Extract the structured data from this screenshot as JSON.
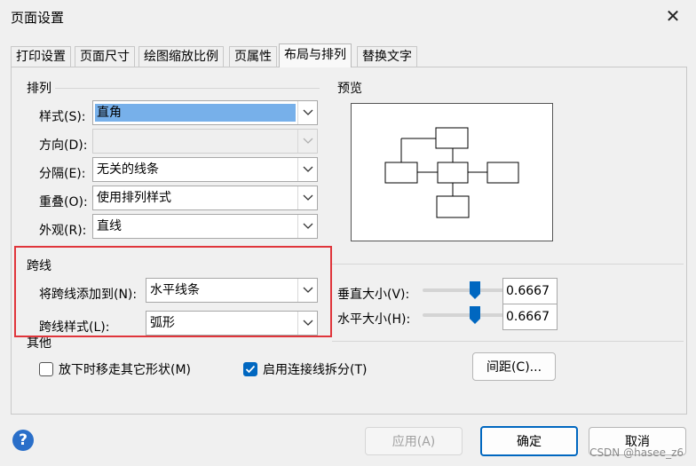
{
  "window": {
    "title": "页面设置",
    "close_symbol": "✕"
  },
  "tabs": [
    {
      "label": "打印设置"
    },
    {
      "label": "页面尺寸"
    },
    {
      "label": "绘图缩放比例"
    },
    {
      "label": "页属性"
    },
    {
      "label": "布局与排列",
      "active": true
    },
    {
      "label": "替换文字"
    }
  ],
  "arrange": {
    "group_label": "排列",
    "style_label": "样式(S):",
    "style_value": "直角",
    "direction_label": "方向(D):",
    "direction_value": "",
    "separation_label": "分隔(E):",
    "separation_value": "无关的线条",
    "overlap_label": "重叠(O):",
    "overlap_value": "使用排列样式",
    "appearance_label": "外观(R):",
    "appearance_value": "直线"
  },
  "preview": {
    "label": "预览"
  },
  "jumps": {
    "group_label": "跨线",
    "add_to_label": "将跨线添加到(N):",
    "add_to_value": "水平线条",
    "style_label": "跨线样式(L):",
    "style_value": "弧形",
    "vertical_size_label": "垂直大小(V):",
    "vertical_size_value": "0.6667",
    "vertical_slider_fraction": 0.6667,
    "horizontal_size_label": "水平大小(H):",
    "horizontal_size_value": "0.6667",
    "horizontal_slider_fraction": 0.6667
  },
  "other": {
    "group_label": "其他",
    "move_shapes_label": "放下时移走其它形状(M)",
    "move_shapes_checked": false,
    "split_connectors_label": "启用连接线拆分(T)",
    "split_connectors_checked": true,
    "spacing_button": "间距(C)..."
  },
  "footer": {
    "help_symbol": "?",
    "apply_button": "应用(A)",
    "ok_button": "确定",
    "cancel_button": "取消"
  },
  "watermark": "CSDN @hasee_z6",
  "colors": {
    "accent": "#0067c0",
    "selection": "#77b0ea",
    "highlight_box": "#e0353b"
  }
}
